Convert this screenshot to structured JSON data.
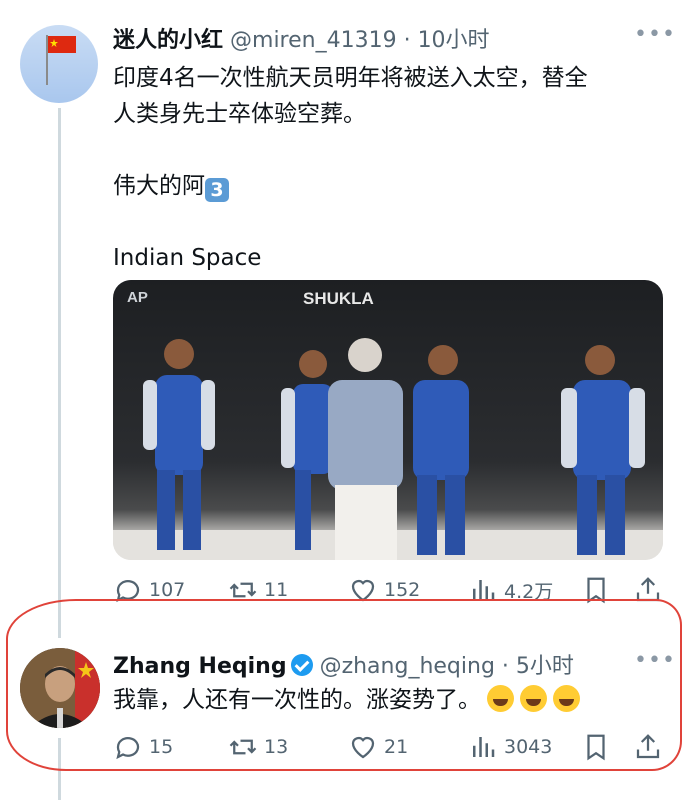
{
  "tweet": {
    "display_name": "迷人的小红",
    "handle_time": "@miren_41319 · 10小时",
    "avatar_flag": "🇨🇳",
    "text_line1": "印度4名一次性航天员明年将被送入太空，替全",
    "text_line2": "人类身先士卒体验空葬。",
    "text_line3": "伟大的阿",
    "keycap": "3",
    "text_line4": "Indian Space",
    "media_label1": "SHUKLA",
    "media_label2": "AP",
    "stats": {
      "replies": "107",
      "retweets": "11",
      "likes": "152",
      "views": "4.2万"
    }
  },
  "reply": {
    "display_name": "Zhang Heqing",
    "handle_time": "@zhang_heqing · 5小时",
    "text": "我靠，人还有一次性的。涨姿势了。",
    "emoji_count": 3,
    "stats": {
      "replies": "15",
      "retweets": "13",
      "likes": "21",
      "views": "3043"
    }
  },
  "colors": {
    "text": "#0f1419",
    "muted": "#536471",
    "verified": "#1d9bf0",
    "highlight": "#e0433a"
  }
}
